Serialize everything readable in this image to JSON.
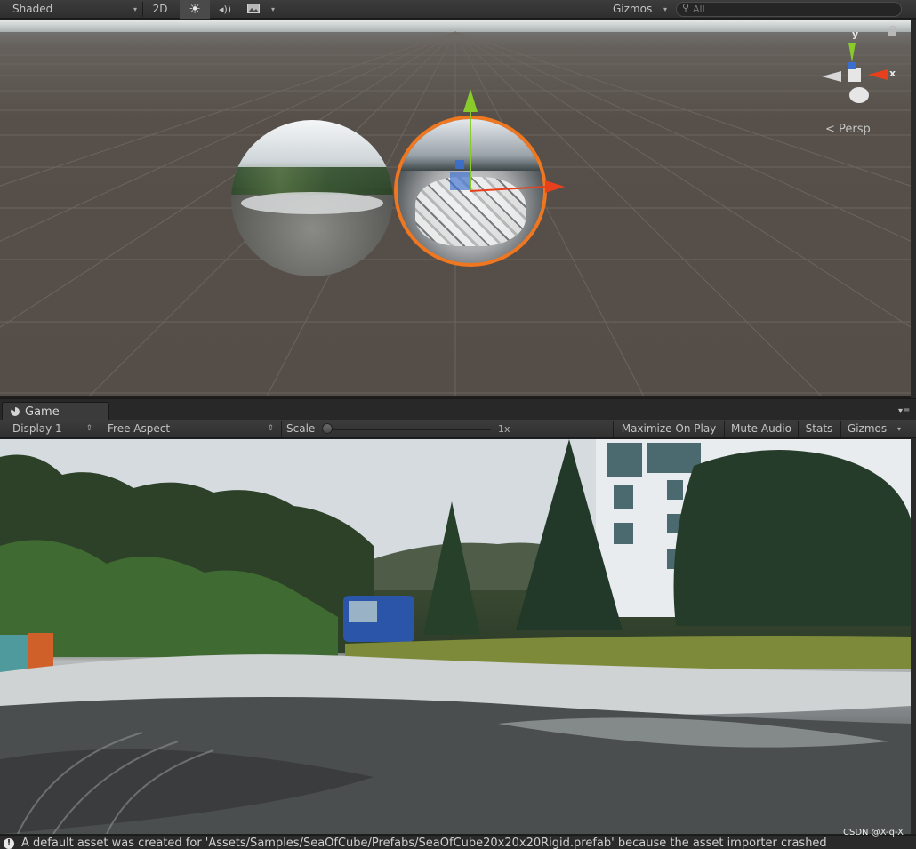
{
  "scene_toolbar": {
    "shading_mode": "Shaded",
    "btn_2d": "2D",
    "light_icon": "☀",
    "audio_icon": "◂))",
    "effects_icon": "image-icon",
    "gizmos_label": "Gizmos",
    "search_placeholder": "All"
  },
  "scene_view": {
    "projection_label": "Persp",
    "axis_labels": {
      "y": "y",
      "x": "x"
    },
    "colors": {
      "selection": "#ef7720",
      "axis_x": "#e8401c",
      "axis_y": "#8acb2c",
      "axis_z": "#3a6fd0"
    }
  },
  "game_tab": {
    "label": "Game"
  },
  "game_toolbar": {
    "display": "Display 1",
    "aspect": "Free Aspect",
    "scale_label": "Scale",
    "scale_value": "1x",
    "maximize": "Maximize On Play",
    "mute": "Mute Audio",
    "stats": "Stats",
    "gizmos": "Gizmos"
  },
  "console": {
    "message": "A default asset was created for 'Assets/Samples/SeaOfCube/Prefabs/SeaOfCube20x20x20Rigid.prefab' because the asset importer crashed"
  },
  "watermark": "CSDN @X-q-X"
}
